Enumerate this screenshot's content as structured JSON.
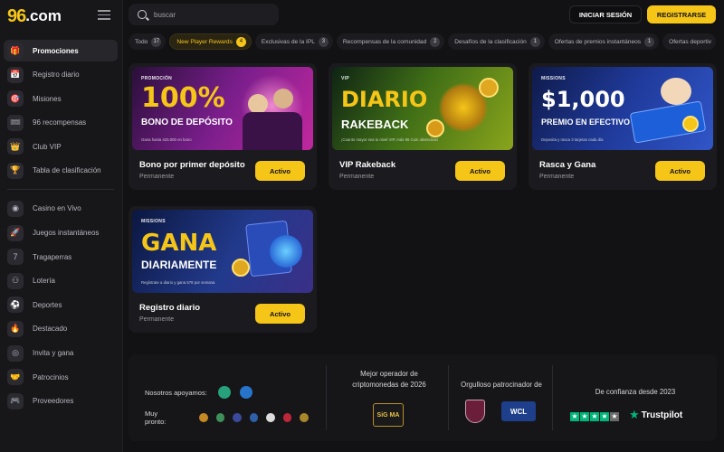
{
  "brand": {
    "logo_mark": "96",
    "logo_text": ".com"
  },
  "search": {
    "placeholder": "buscar"
  },
  "header": {
    "login_label": "INICIAR SESIÓN",
    "register_label": "REGISTRARSE"
  },
  "sidebar": {
    "group1": [
      {
        "label": "Promociones",
        "icon": "gift-icon",
        "glyph": "🎁",
        "active": true
      },
      {
        "label": "Registro diario",
        "icon": "calendar-icon",
        "glyph": "📅"
      },
      {
        "label": "Misiones",
        "icon": "mission-icon",
        "glyph": "🎯"
      },
      {
        "label": "96 recompensas",
        "icon": "reward-icon",
        "glyph": "🎟"
      },
      {
        "label": "Club VIP",
        "icon": "crown-icon",
        "glyph": "👑"
      },
      {
        "label": "Tabla de clasificación",
        "icon": "trophy-icon",
        "glyph": "🏆"
      }
    ],
    "group2": [
      {
        "label": "Casino en Vivo",
        "icon": "live-casino-icon",
        "glyph": "◉"
      },
      {
        "label": "Juegos instantáneos",
        "icon": "rocket-icon",
        "glyph": "🚀"
      },
      {
        "label": "Tragaperras",
        "icon": "slot-seven-icon",
        "glyph": "7"
      },
      {
        "label": "Lotería",
        "icon": "lottery-balls-icon",
        "glyph": "⚇"
      },
      {
        "label": "Deportes",
        "icon": "soccer-ball-icon",
        "glyph": "⚽"
      },
      {
        "label": "Destacado",
        "icon": "flame-icon",
        "glyph": "🔥"
      },
      {
        "label": "Invita y gana",
        "icon": "invite-icon",
        "glyph": "◎"
      },
      {
        "label": "Patrocinios",
        "icon": "handshake-icon",
        "glyph": "🤝"
      },
      {
        "label": "Proveedores",
        "icon": "gamepad-icon",
        "glyph": "🎮"
      }
    ]
  },
  "filters": [
    {
      "label": "Todo",
      "count": "17"
    },
    {
      "label": "New Player Rewards",
      "count": "4",
      "active": true
    },
    {
      "label": "Exclusivas de la IPL",
      "count": "3"
    },
    {
      "label": "Recompensas de la comunidad",
      "count": "2"
    },
    {
      "label": "Desafíos de la clasificación",
      "count": "1"
    },
    {
      "label": "Ofertas de premios instantáneos",
      "count": "1"
    },
    {
      "label": "Ofertas deportiv",
      "count": ""
    }
  ],
  "cards": [
    {
      "banner_tag": "PROMOCIÓN",
      "banner_big": "100%",
      "banner_mid": "BONO DE DEPÓSITO",
      "banner_fine": "Gana hasta 425.000 en bono",
      "title": "Bono por primer depósito",
      "subtitle": "Permanente",
      "button": "Activo"
    },
    {
      "banner_tag": "VIP",
      "banner_big": "DIARIO",
      "banner_mid": "RAKEBACK",
      "banner_fine": "¡Cuanto mayor sea tu nivel VIP, más 96 Coin obtendrás!",
      "title": "VIP Rakeback",
      "subtitle": "Permanente",
      "button": "Activo"
    },
    {
      "banner_tag": "MISSIONS",
      "banner_big": "$1,000",
      "banner_mid": "PREMIO EN EFECTIVO",
      "banner_fine": "Deposita y rasca 3 tarjetas cada día",
      "title": "Rasca y Gana",
      "subtitle": "Permanente",
      "button": "Activo"
    },
    {
      "banner_tag": "MISSIONS",
      "banner_big": "GANA",
      "banner_mid": "DIARIAMENTE",
      "banner_fine": "Regístrate a diario y gana 578 por semana",
      "title": "Registro diario",
      "subtitle": "Permanente",
      "button": "Activo"
    }
  ],
  "footer": {
    "support_label": "Nosotros apoyamos:",
    "soon_label": "Muy pronto:",
    "operator_line1": "Mejor operador de",
    "operator_line2": "criptomonedas de 2026",
    "sigma_text": "SiG MA",
    "sponsor_label": "Orgulloso patrocinador de",
    "wcl_text": "WCL",
    "trust_label": "De confianza desde 2023",
    "trustpilot": "Trustpilot"
  },
  "colors": {
    "accent": "#f5c518",
    "background": "#121214",
    "trustpilot_green": "#00b67a"
  }
}
